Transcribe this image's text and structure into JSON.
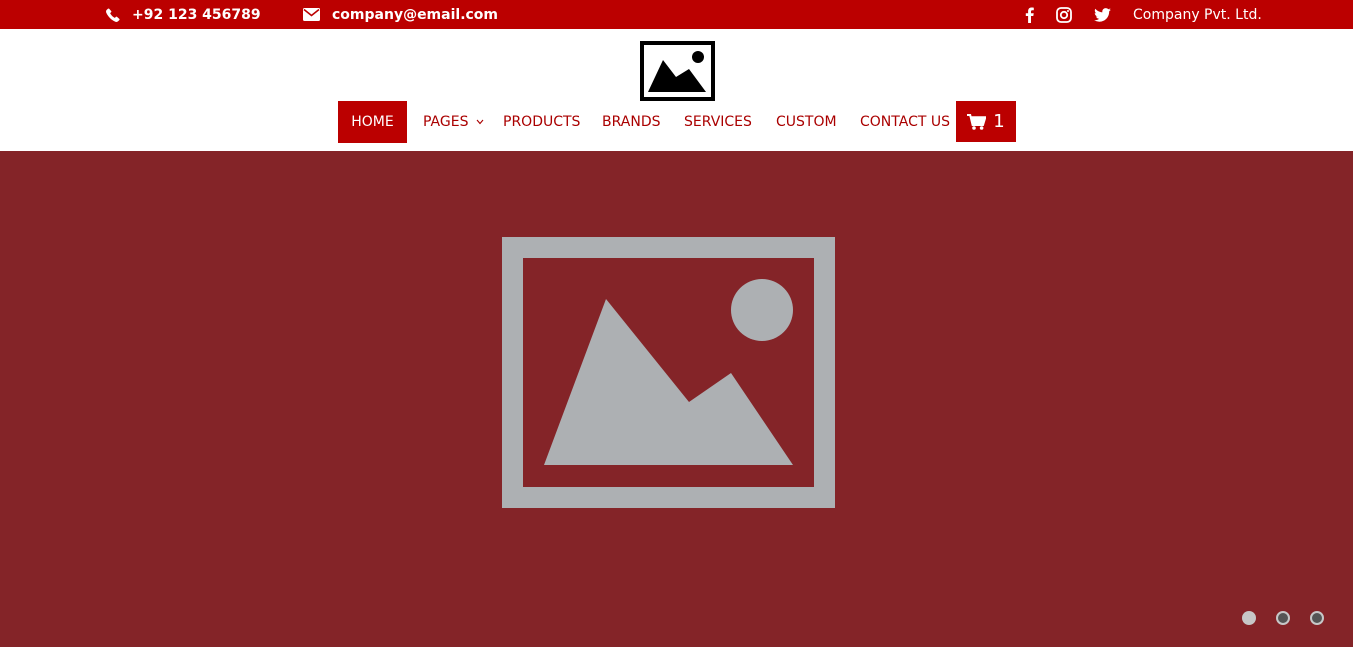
{
  "topbar": {
    "phone": "+92 123 456789",
    "phone_icon": "phone-icon",
    "email": "company@email.com",
    "email_icon": "envelope-icon",
    "social_icons": [
      "facebook-icon",
      "instagram-icon",
      "twitter-icon"
    ],
    "company": "Company Pvt. Ltd."
  },
  "header": {
    "logo_icon": "image-placeholder-icon"
  },
  "nav": {
    "items": [
      {
        "label": "HOME",
        "active": true
      },
      {
        "label": "PAGES",
        "has_dropdown": true
      },
      {
        "label": "PRODUCTS"
      },
      {
        "label": "BRANDS"
      },
      {
        "label": "SERVICES"
      },
      {
        "label": "CUSTOM"
      },
      {
        "label": "CONTACT US"
      }
    ],
    "cart_icon": "shopping-cart-icon",
    "cart_count": "1"
  },
  "hero": {
    "image_icon": "image-placeholder-icon",
    "slide_count": 3,
    "active_slide": 1
  },
  "colors": {
    "topbar_bg": "#bb0000",
    "accent": "#bb0000",
    "nav_text": "#aa0000",
    "hero_bg": "#842428",
    "placeholder": "#adb0b3"
  }
}
